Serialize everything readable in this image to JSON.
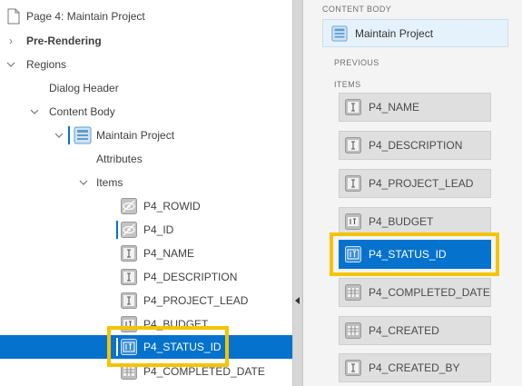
{
  "tree": {
    "page_title": "Page 4: Maintain Project",
    "pre_rendering": "Pre-Rendering",
    "regions": "Regions",
    "dialog_header": "Dialog Header",
    "content_body": "Content Body",
    "region_name": "Maintain Project",
    "attributes": "Attributes",
    "items_label": "Items",
    "items": [
      {
        "label": "P4_ROWID",
        "icon": "hidden-item-icon"
      },
      {
        "label": "P4_ID",
        "icon": "hidden-item-icon"
      },
      {
        "label": "P4_NAME",
        "icon": "text-field-icon"
      },
      {
        "label": "P4_DESCRIPTION",
        "icon": "text-field-icon"
      },
      {
        "label": "P4_PROJECT_LEAD",
        "icon": "text-field-icon"
      },
      {
        "label": "P4_BUDGET",
        "icon": "number-field-icon"
      },
      {
        "label": "P4_STATUS_ID",
        "icon": "number-field-icon",
        "selected": true
      },
      {
        "label": "P4_COMPLETED_DATE",
        "icon": "date-picker-icon"
      }
    ]
  },
  "layout": {
    "section_title": "CONTENT BODY",
    "region_label": "Maintain Project",
    "previous_label": "PREVIOUS",
    "items_label": "ITEMS",
    "items": [
      {
        "label": "P4_NAME",
        "icon": "text-field-icon"
      },
      {
        "label": "P4_DESCRIPTION",
        "icon": "text-field-icon"
      },
      {
        "label": "P4_PROJECT_LEAD",
        "icon": "text-field-icon"
      },
      {
        "label": "P4_BUDGET",
        "icon": "number-field-icon"
      },
      {
        "label": "P4_STATUS_ID",
        "icon": "number-field-icon",
        "selected": true
      },
      {
        "label": "P4_COMPLETED_DATE",
        "icon": "date-picker-icon"
      },
      {
        "label": "P4_CREATED",
        "icon": "date-picker-icon"
      },
      {
        "label": "P4_CREATED_BY",
        "icon": "text-field-icon"
      }
    ]
  },
  "colors": {
    "selection": "#0572ce",
    "highlight": "#f5c400"
  }
}
